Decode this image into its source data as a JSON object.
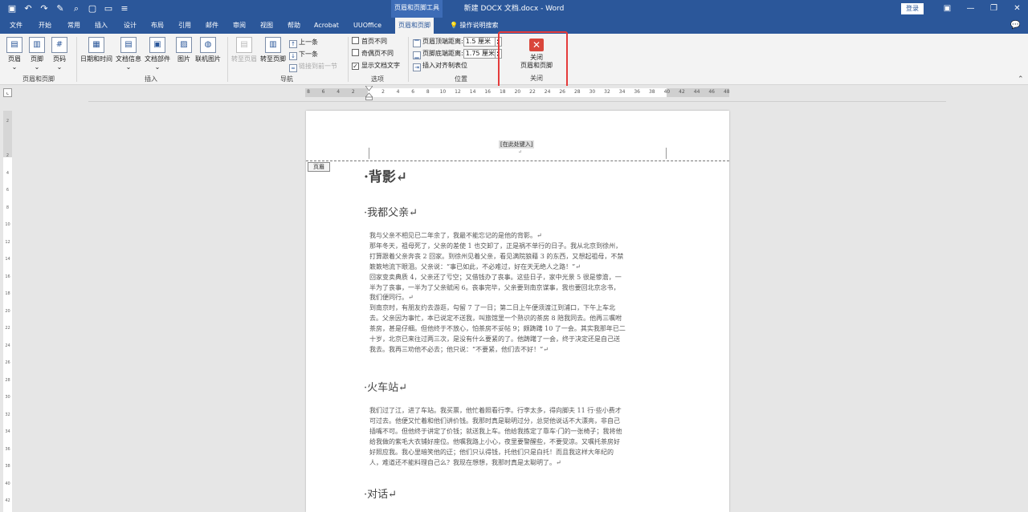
{
  "titlebar": {
    "qat_icons": [
      "save-icon",
      "undo-icon",
      "redo-icon",
      "format-painter-icon",
      "print-preview-icon",
      "new-icon",
      "open-icon",
      "customize-icon"
    ],
    "qat_glyphs": [
      "▣",
      "↶",
      "↷",
      "✎",
      "⌕",
      "▢",
      "▭",
      "≡"
    ],
    "context_label": "页眉和页脚工具",
    "doc_title": "新建 DOCX 文档.docx  -  Word",
    "login_label": "登录",
    "window_controls": [
      "▣",
      "—",
      "❐",
      "✕"
    ]
  },
  "tabs": [
    {
      "label": "文件"
    },
    {
      "label": "开始"
    },
    {
      "label": "常用"
    },
    {
      "label": "插入"
    },
    {
      "label": "设计"
    },
    {
      "label": "布局"
    },
    {
      "label": "引用"
    },
    {
      "label": "邮件"
    },
    {
      "label": "审阅"
    },
    {
      "label": "视图"
    },
    {
      "label": "帮助"
    },
    {
      "label": "Acrobat"
    },
    {
      "label": "UUOffice"
    },
    {
      "label": "页眉和页脚"
    }
  ],
  "search_tab": "操作说明搜索",
  "ribbon": {
    "group_headerfooter": {
      "label": "页眉和页脚",
      "buttons": [
        {
          "label": "页眉",
          "glyph": "▤"
        },
        {
          "label": "页脚",
          "glyph": "▥"
        },
        {
          "label": "页码",
          "glyph": "#"
        }
      ]
    },
    "group_insert": {
      "label": "插入",
      "buttons": [
        {
          "label": "日期和时间",
          "glyph": "▦"
        },
        {
          "label": "文档信息",
          "glyph": "▤"
        },
        {
          "label": "文档部件",
          "glyph": "▣"
        },
        {
          "label": "图片",
          "glyph": "▨"
        },
        {
          "label": "联机图片",
          "glyph": "◍"
        }
      ]
    },
    "group_nav": {
      "label": "导航",
      "goto_header": "转至页眉",
      "goto_footer": "转至页脚",
      "prev": "上一条",
      "next": "下一条",
      "link_prev": "链接到前一节"
    },
    "group_options": {
      "label": "选项",
      "first_page": "首页不同",
      "odd_even": "奇偶页不同",
      "show_text": "显示文档文字",
      "checked_glyph": "✓"
    },
    "group_position": {
      "label": "位置",
      "header_top_label": "页眉顶端距离:",
      "header_top_value": "1.5 厘米",
      "footer_bottom_label": "页脚底端距离:",
      "footer_bottom_value": "1.75 厘米",
      "align_tab": "插入对齐制表位"
    },
    "group_close": {
      "label": "关闭",
      "close_line1": "关闭",
      "close_line2": "页眉和页脚",
      "glyph": "✕"
    }
  },
  "ruler": {
    "numbers": [
      "8",
      "6",
      "4",
      "2",
      "",
      "2",
      "4",
      "6",
      "8",
      "10",
      "12",
      "14",
      "16",
      "18",
      "20",
      "22",
      "24",
      "26",
      "28",
      "30",
      "32",
      "34",
      "36",
      "38",
      "40",
      "42",
      "44",
      "46",
      "48"
    ]
  },
  "vruler_numbers": [
    "2",
    "",
    "2",
    "4",
    "6",
    "8",
    "10",
    "12",
    "14",
    "16",
    "18",
    "20",
    "22",
    "24",
    "26",
    "28",
    "30",
    "32",
    "34",
    "36",
    "38",
    "40",
    "42"
  ],
  "document": {
    "header_placeholder": "[在此处键入]",
    "header_tag": "页眉",
    "title": "·背影↵",
    "sections": [
      {
        "heading": "·我都父亲↵",
        "lines": [
          "我与父亲不相见已二年余了，我最不能忘记的是他的背影。↵",
          "那年冬天，祖母死了，父亲的差使 1 也交卸了，正是祸不单行的日子。我从北京到徐州，",
          "打算跟着父亲奔丧 2 回家。到徐州见着父亲，看见满院狼藉 3 的东西，又想起祖母，不禁",
          "簌簌地流下眼泪。父亲说：“事已如此，不必难过，好在天无绝人之路！”↵",
          "回家变卖典质 4，父亲还了亏空；又借钱办了丧事。这些日子，家中光景 5 很是惨澹，一",
          "半为了丧事，一半为了父亲赋闲 6。丧事完毕，父亲要到南京谋事，我也要回北京念书，",
          "我们便同行。↵",
          "到南京时，有朋友约去游逛，勾留 7 了一日；第二日上午便须渡江到浦口，下午上车北",
          "去。父亲因为事忙，本已说定不送我，叫旅馆里一个熟识的茶房 8 陪我同去。他再三嘱咐",
          "茶房，甚是仔细。但他终于不放心，怕茶房不妥帖 9；颇踌躇 10 了一会。其实我那年已二",
          "十岁，北京已来往过两三次，是没有什么要紧的了。他踌躇了一会，终于决定还是自己送",
          "我去。我再三劝他不必去；他只说：“不要紧，他们去不好！”↵"
        ]
      },
      {
        "heading": "·火车站↵",
        "lines": [
          "我们过了江，进了车站。我买票，他忙着照看行李。行李太多，得向脚夫 11 行·些小费才",
          "可过去。他便又忙着和他们讲价钱。我那时真是聪明过分，总觉他说话不大漂亮，非自己",
          "插嘴不可。但他终于讲定了价钱；就送我上车。他给我拣定了靠车·门的一张椅子；我将他",
          "给我做的紫毛大衣铺好座位。他嘱我路上小心，夜里要警醒些，不要受凉。又嘱托茶房好",
          "好照应我。我心里暗笑他的迂；他们只认得钱，托他们只是白托！而且我这样大年纪的",
          "人，难道还不能料理自己么？我现在想想，我那时真是太聪明了。↵"
        ]
      },
      {
        "heading": "·对话↵",
        "lines": []
      }
    ]
  }
}
